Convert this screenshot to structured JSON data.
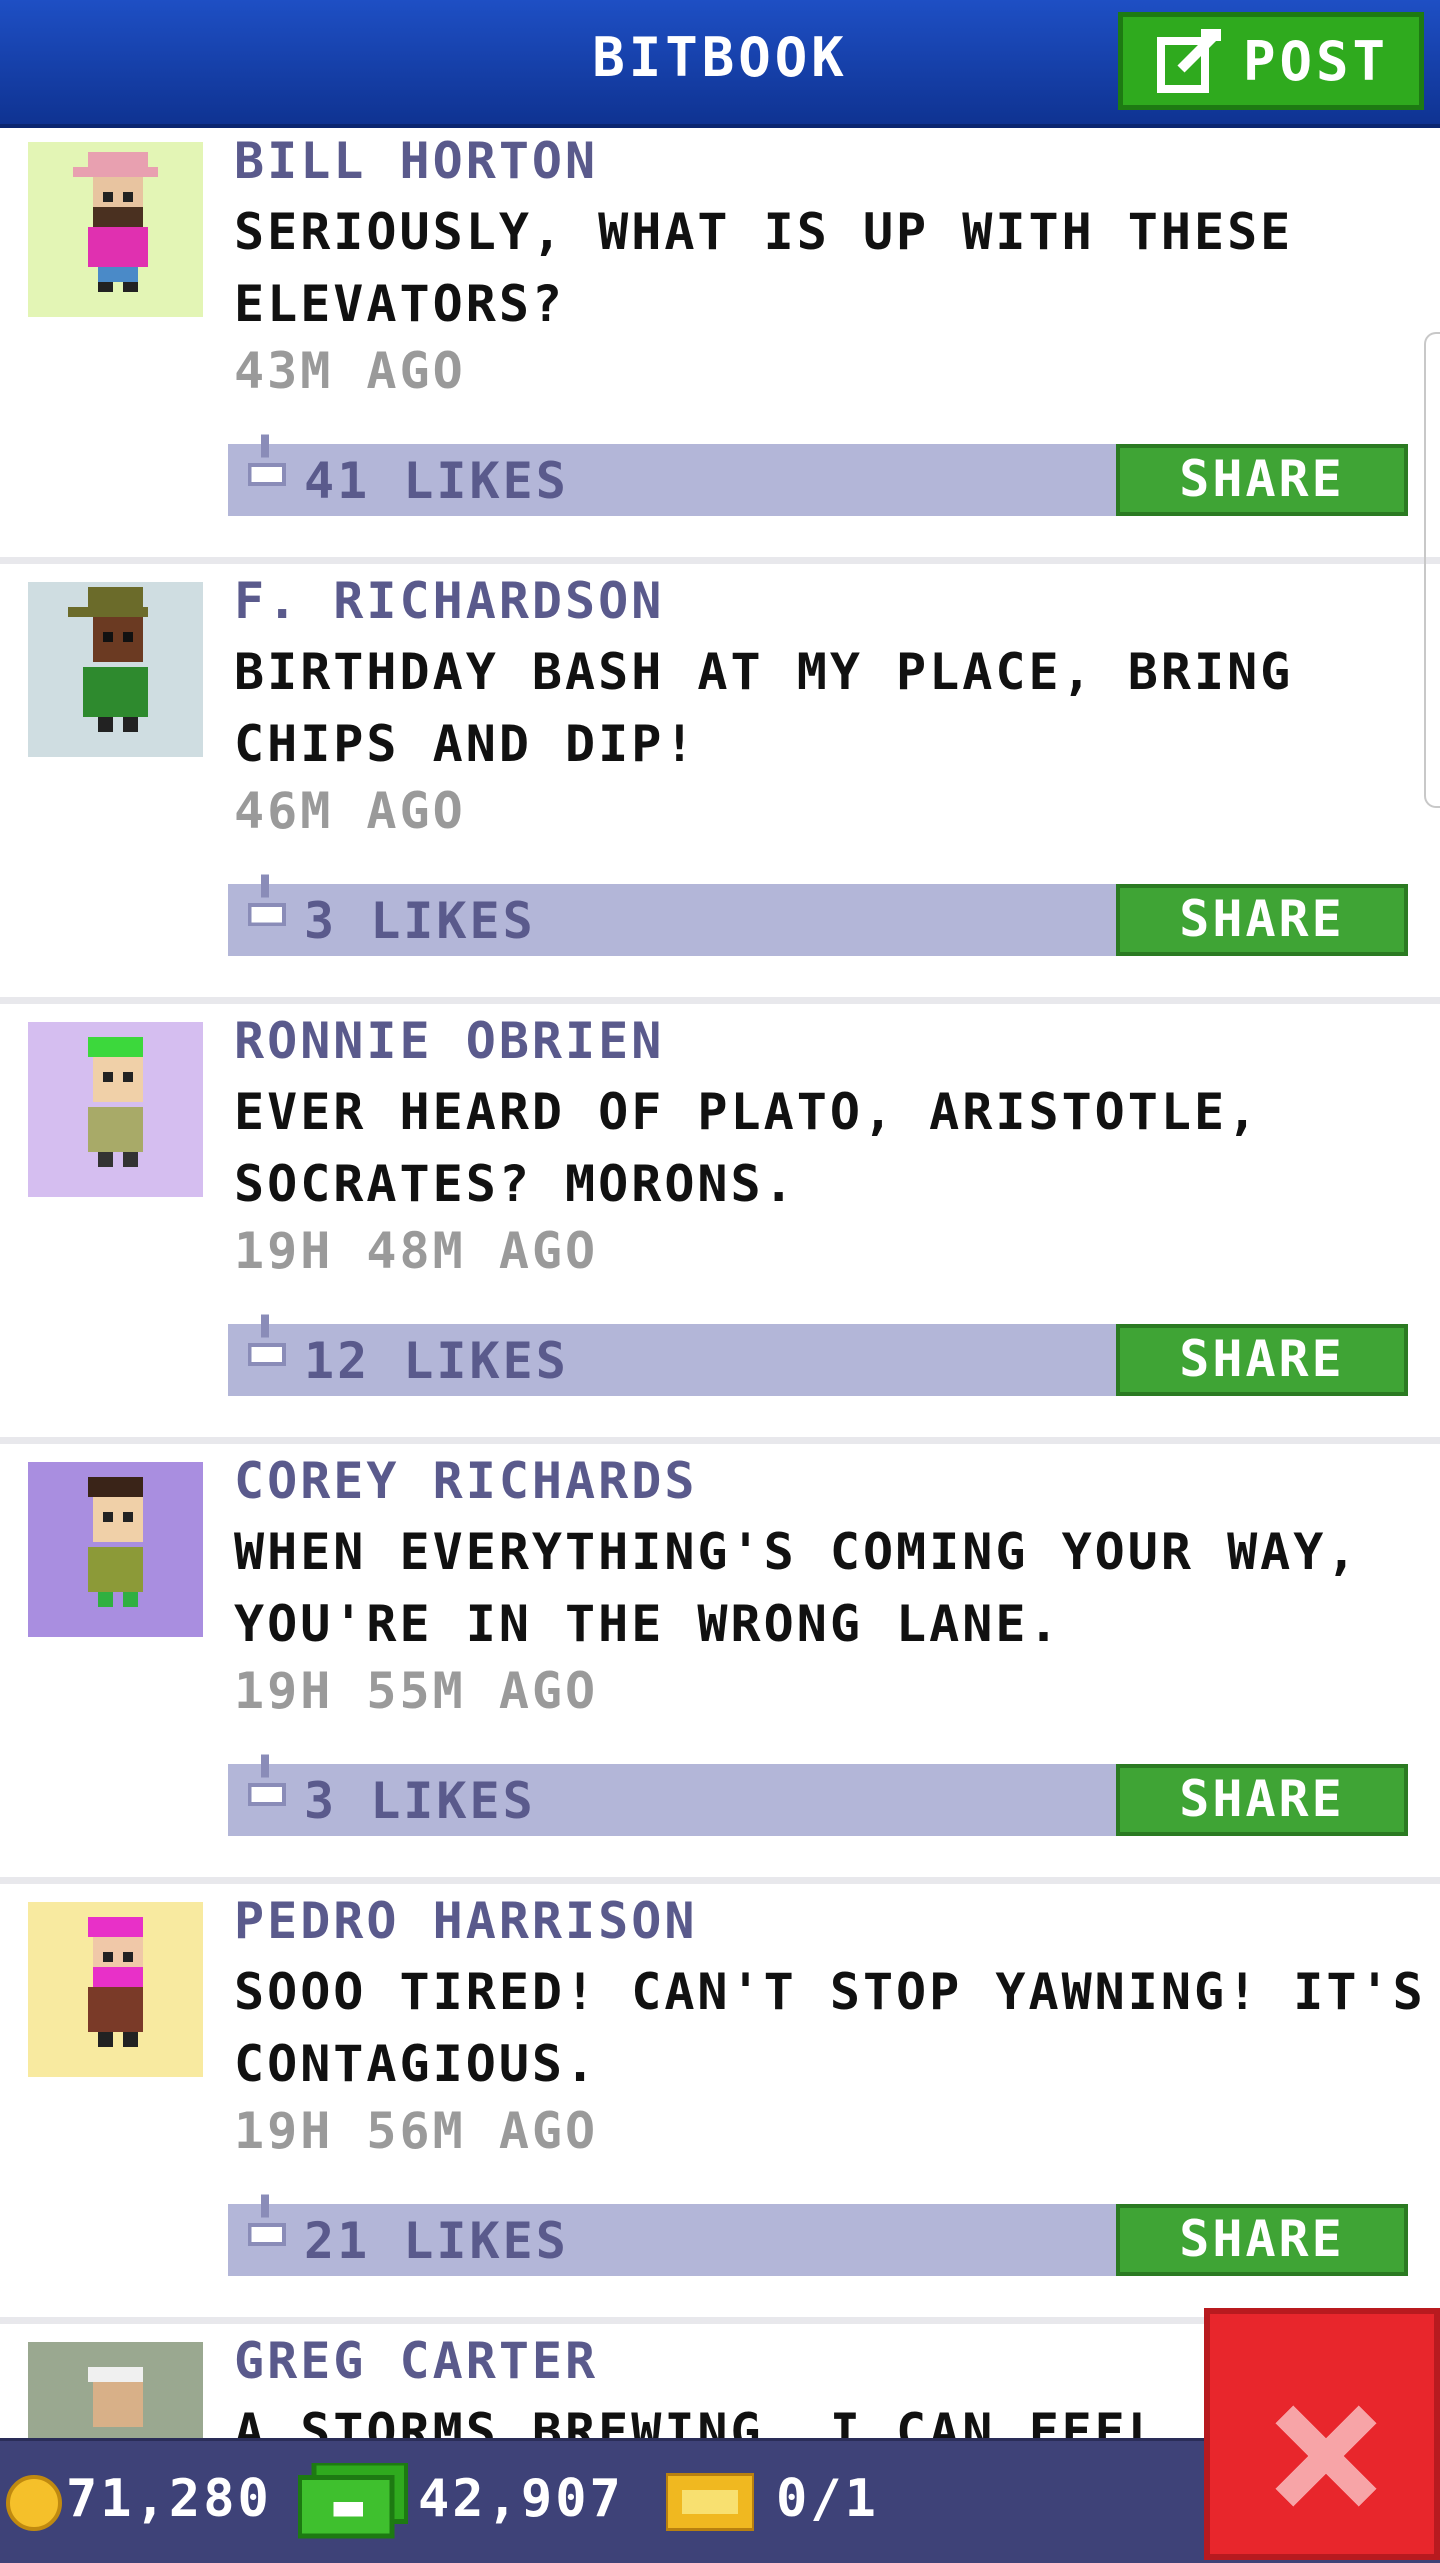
{
  "header": {
    "title": "BITBOOK",
    "post_label": "POST"
  },
  "posts": [
    {
      "name": "BILL HORTON",
      "message": "SERIOUSLY, WHAT IS UP WITH THESE ELEVATORS?",
      "time": "43M AGO",
      "likes": "41 LIKES",
      "share": "SHARE"
    },
    {
      "name": "F. RICHARDSON",
      "message": "BIRTHDAY BASH AT MY PLACE, BRING CHIPS AND DIP!",
      "time": "46M AGO",
      "likes": "3 LIKES",
      "share": "SHARE"
    },
    {
      "name": "RONNIE OBRIEN",
      "message": "EVER HEARD OF PLATO, ARISTOTLE, SOCRATES? MORONS.",
      "time": "19H 48M AGO",
      "likes": "12 LIKES",
      "share": "SHARE"
    },
    {
      "name": "COREY RICHARDS",
      "message": "WHEN EVERYTHING'S COMING YOUR WAY, YOU'RE IN THE WRONG LANE.",
      "time": "19H 55M AGO",
      "likes": "3 LIKES",
      "share": "SHARE"
    },
    {
      "name": "PEDRO HARRISON",
      "message": "SOOO TIRED! CAN'T STOP YAWNING! IT'S CONTAGIOUS.",
      "time": "19H 56M AGO",
      "likes": "21 LIKES",
      "share": "SHARE"
    },
    {
      "name": "GREG CARTER",
      "message": "A STORMS BREWING, I CAN FEEL"
    }
  ],
  "status": {
    "coins": "71,280",
    "bux": "42,907",
    "tickets": "0/1"
  },
  "colors": {
    "header": "#1e4fc4",
    "share": "#3fa435",
    "like_bar": "#b3b6d8",
    "name_text": "#5a5a8c",
    "close": "#e8262c"
  }
}
